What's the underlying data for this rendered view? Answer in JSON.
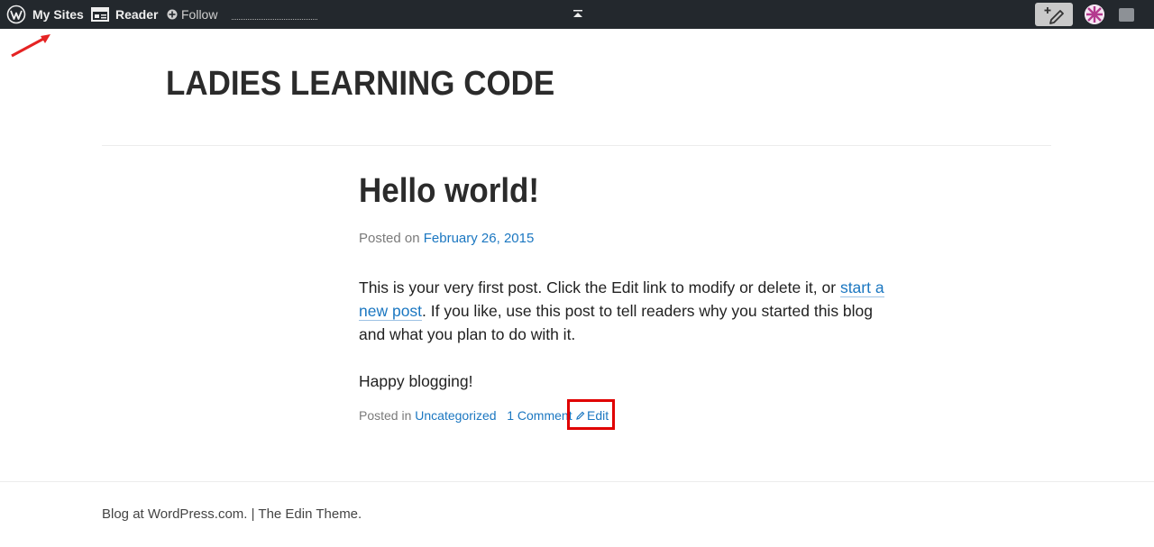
{
  "adminbar": {
    "my_sites": "My Sites",
    "reader": "Reader",
    "follow": "Follow"
  },
  "site": {
    "title": "LADIES LEARNING CODE"
  },
  "post": {
    "title": "Hello world!",
    "posted_on_label": "Posted on",
    "date": "February 26, 2015",
    "body_1_before": "This is your very first post. Click the Edit link to modify or delete it, or ",
    "body_1_link": "start a new post",
    "body_1_after": ". If you like, use this post to tell readers why you started this blog and what you plan to do with it.",
    "body_2": "Happy blogging!",
    "posted_in_label": "Posted in",
    "category": "Uncategorized",
    "comments": "1 Comment",
    "edit": "Edit"
  },
  "footer": {
    "text": "Blog at WordPress.com. | The Edin Theme."
  },
  "colors": {
    "adminbar_bg": "#23282d",
    "link": "#1b77c1",
    "highlight": "#e00000"
  }
}
